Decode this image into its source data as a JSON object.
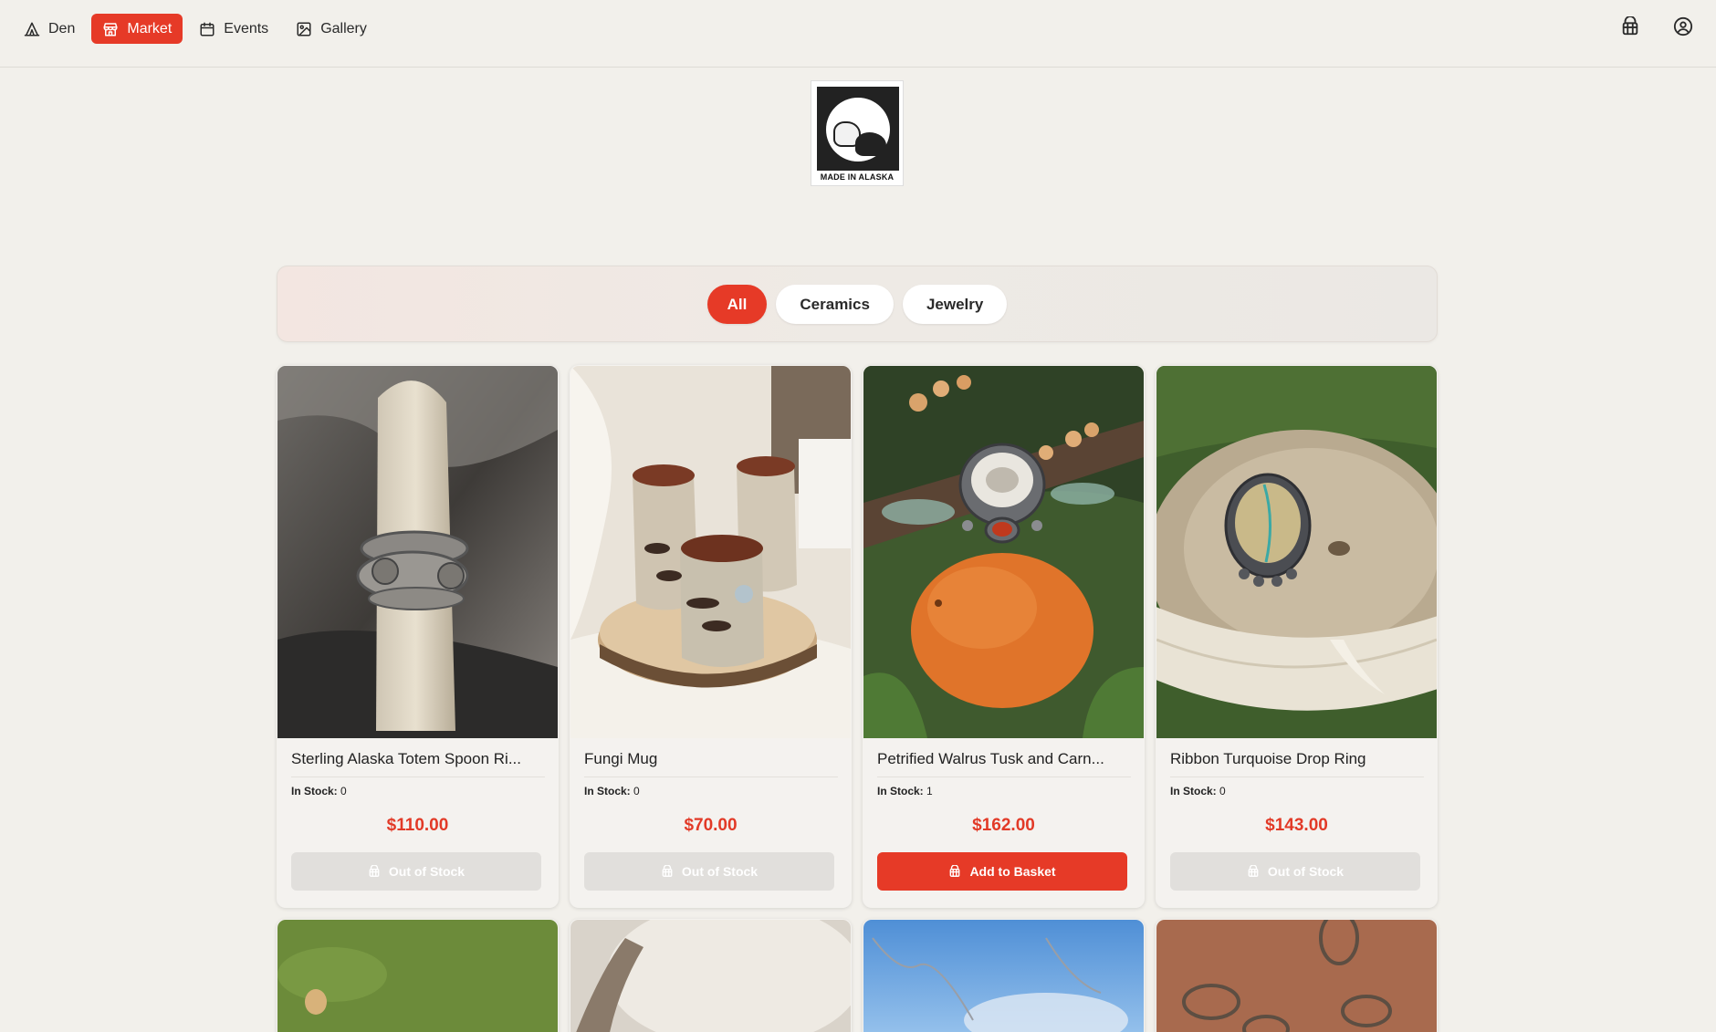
{
  "nav": {
    "items": [
      {
        "label": "Den",
        "icon": "tent-icon"
      },
      {
        "label": "Market",
        "icon": "store-icon"
      },
      {
        "label": "Events",
        "icon": "calendar-icon"
      },
      {
        "label": "Gallery",
        "icon": "image-icon"
      }
    ],
    "active": "Market",
    "right_icons": [
      "basket-icon",
      "user-circle-icon"
    ]
  },
  "logo": {
    "caption": "MADE IN ALASKA"
  },
  "filters": {
    "options": [
      "All",
      "Ceramics",
      "Jewelry"
    ],
    "selected": "All"
  },
  "products": [
    {
      "title": "Sterling Alaska Totem Spoon Ri...",
      "stock_label": "In Stock:",
      "stock": "0",
      "price": "$110.00",
      "button": "Out of Stock",
      "available": false
    },
    {
      "title": "Fungi Mug",
      "stock_label": "In Stock:",
      "stock": "0",
      "price": "$70.00",
      "button": "Out of Stock",
      "available": false
    },
    {
      "title": "Petrified Walrus Tusk and Carn...",
      "stock_label": "In Stock:",
      "stock": "1",
      "price": "$162.00",
      "button": "Add to Basket",
      "available": true
    },
    {
      "title": "Ribbon Turquoise Drop Ring",
      "stock_label": "In Stock:",
      "stock": "0",
      "price": "$143.00",
      "button": "Out of Stock",
      "available": false
    }
  ],
  "colors": {
    "accent": "#e63a27",
    "background": "#f2f0eb",
    "disabled": "#e1dfdc"
  }
}
